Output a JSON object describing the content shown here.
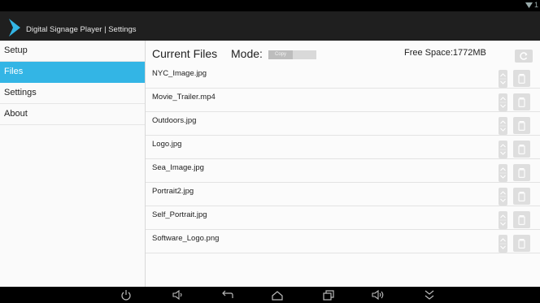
{
  "app": {
    "title": "Digital Signage Player | Settings",
    "accent_color": "#33b5e5",
    "logo_icon": "chevron-logo-icon"
  },
  "statusbar": {
    "icons": [
      "wifi-icon",
      "battery-icon"
    ],
    "time": "1"
  },
  "sidebar": {
    "items": [
      {
        "label": "Setup",
        "active": false
      },
      {
        "label": "Files",
        "active": true
      },
      {
        "label": "Settings",
        "active": false
      },
      {
        "label": "About",
        "active": false
      }
    ]
  },
  "content": {
    "heading": "Current Files",
    "mode_label": "Mode:",
    "mode_value": "Copy",
    "free_space": "Free Space:1772MB",
    "refresh_icon": "refresh-icon",
    "files": [
      {
        "name": "NYC_Image.jpg"
      },
      {
        "name": "Movie_Trailer.mp4"
      },
      {
        "name": "Outdoors.jpg"
      },
      {
        "name": "Logo.jpg"
      },
      {
        "name": "Sea_Image.jpg"
      },
      {
        "name": "Portrait2.jpg"
      },
      {
        "name": "Self_Portrait.jpg"
      },
      {
        "name": "Software_Logo.png"
      }
    ],
    "row_icons": [
      "move-up-icon",
      "move-down-icon",
      "trash-icon"
    ]
  },
  "navbar": {
    "icons": [
      "power-icon",
      "volume-down-icon",
      "back-icon",
      "home-icon",
      "recent-apps-icon",
      "volume-up-icon",
      "collapse-icon"
    ]
  }
}
